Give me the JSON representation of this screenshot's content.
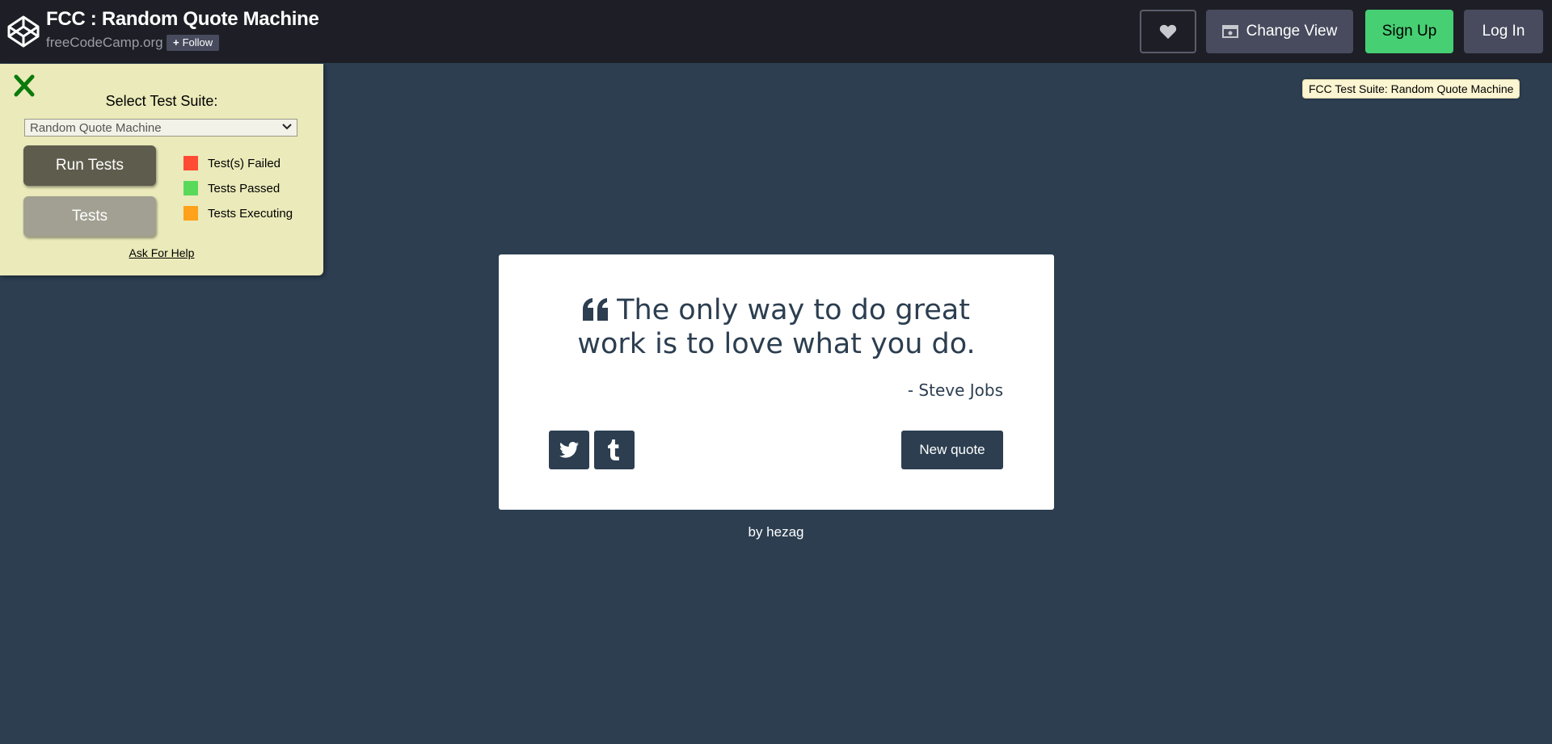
{
  "header": {
    "title": "FCC : Random Quote Machine",
    "owner": "freeCodeCamp.org",
    "follow_label": "Follow",
    "change_view_label": "Change View",
    "signup_label": "Sign Up",
    "login_label": "Log In",
    "icons": [
      "codepen-logo-icon",
      "heart-icon",
      "change-view-icon"
    ]
  },
  "test_panel": {
    "select_label": "Select Test Suite:",
    "selected_suite": "Random Quote Machine",
    "run_tests_label": "Run Tests",
    "tests_label": "Tests",
    "legend": [
      {
        "label": "Test(s) Failed",
        "color": "#ff4b33"
      },
      {
        "label": "Tests Passed",
        "color": "#59d95a"
      },
      {
        "label": "Tests Executing",
        "color": "#ffa11a"
      }
    ],
    "help_label": "Ask For Help"
  },
  "suite_tag": "FCC Test Suite: Random Quote Machine",
  "quote": {
    "text": "The only way to do great work is to love what you do.",
    "author": "- Steve Jobs",
    "new_quote_label": "New quote"
  },
  "byline": {
    "prefix": "by ",
    "author": "hezag"
  },
  "colors": {
    "background": "#2c3e50",
    "topbar": "#1e1f26",
    "panel": "#eaeaba",
    "accent_green": "#47cf73"
  }
}
